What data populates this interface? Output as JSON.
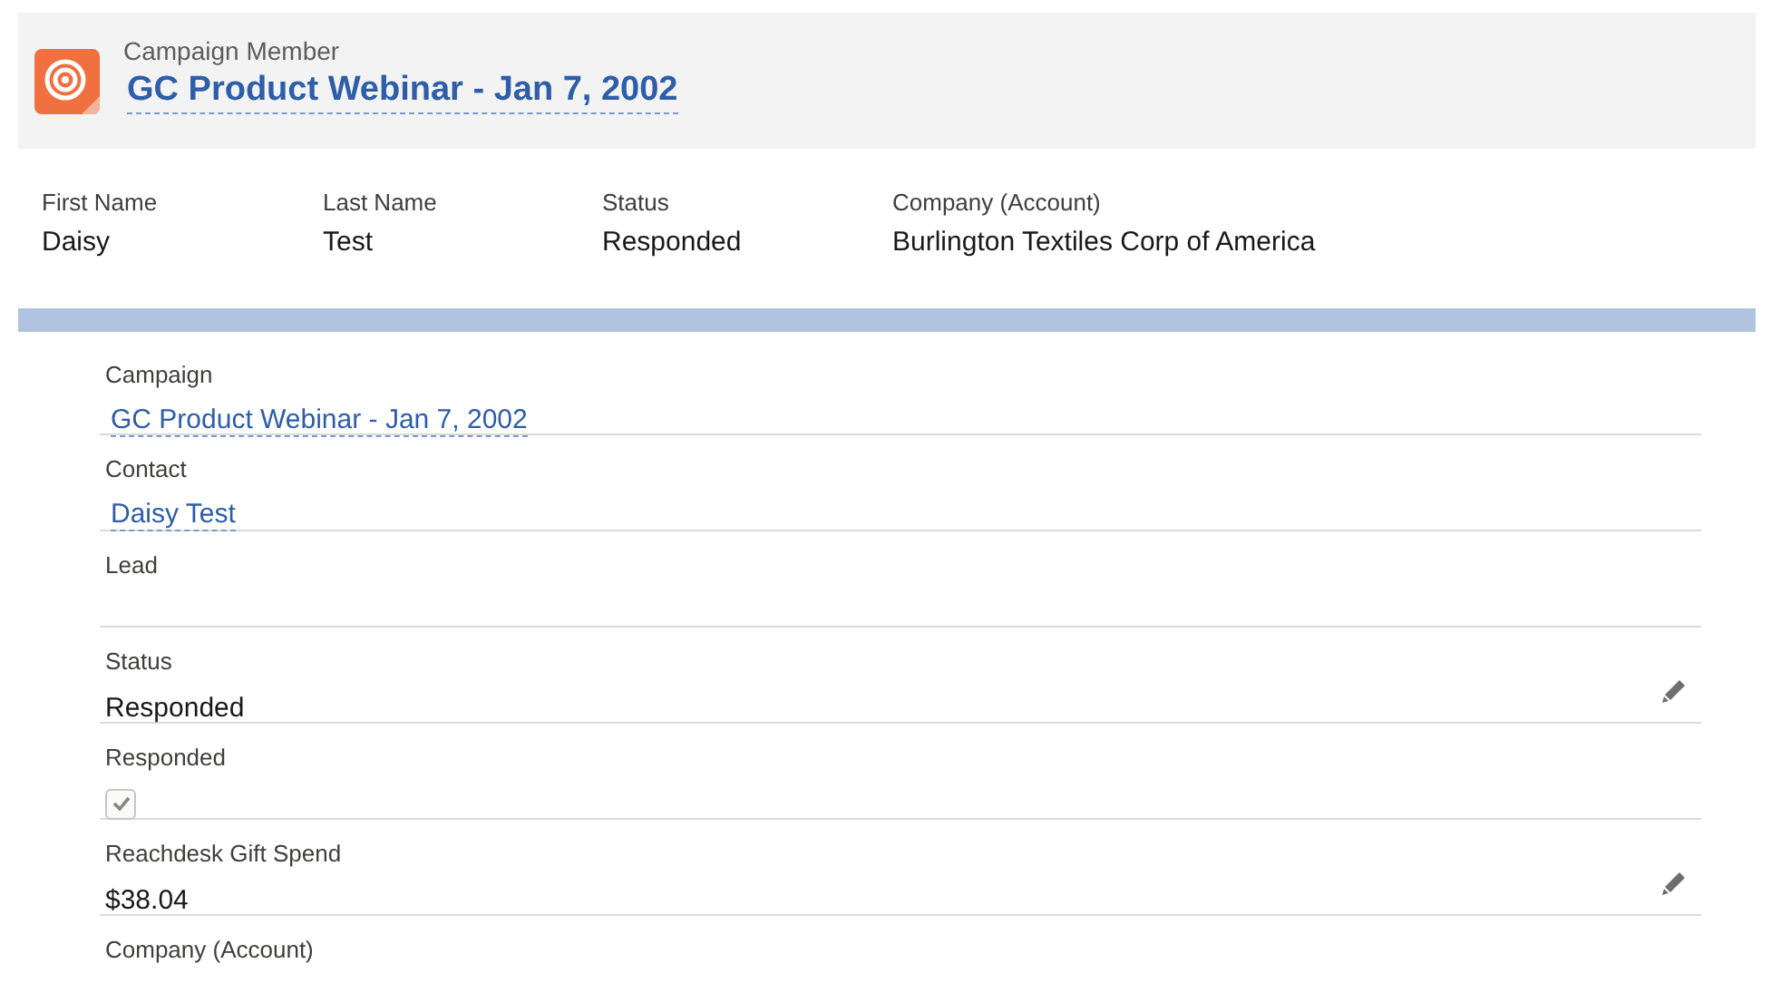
{
  "header": {
    "object_type": "Campaign Member",
    "title": "GC Product Webinar - Jan 7, 2002"
  },
  "highlights": [
    {
      "label": "First Name",
      "value": "Daisy"
    },
    {
      "label": "Last Name",
      "value": "Test"
    },
    {
      "label": "Status",
      "value": "Responded"
    },
    {
      "label": "Company (Account)",
      "value": "Burlington Textiles Corp of America"
    }
  ],
  "fields": [
    {
      "label": "Campaign",
      "kind": "link",
      "value": "GC Product Webinar - Jan 7, 2002",
      "editable": false
    },
    {
      "label": "Contact",
      "kind": "link",
      "value": "Daisy Test",
      "editable": false
    },
    {
      "label": "Lead",
      "kind": "empty",
      "editable": false
    },
    {
      "label": "Status",
      "kind": "text",
      "value": "Responded",
      "editable": true
    },
    {
      "label": "Responded",
      "kind": "checkbox",
      "checked": true,
      "editable": false
    },
    {
      "label": "Reachdesk Gift Spend",
      "kind": "text",
      "value": "$38.04",
      "editable": true
    },
    {
      "label": "Company (Account)",
      "kind": "empty",
      "editable": false
    }
  ]
}
